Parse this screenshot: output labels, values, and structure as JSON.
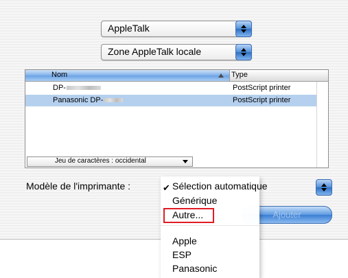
{
  "connection_popup": {
    "value": "AppleTalk"
  },
  "zone_popup": {
    "value": "Zone AppleTalk locale"
  },
  "printer_list": {
    "columns": [
      "Nom",
      "Type"
    ],
    "rows": [
      {
        "name": "DP-",
        "type": "PostScript printer",
        "selected": false
      },
      {
        "name": "Panasonic DP-",
        "type": "PostScript printer",
        "selected": true
      }
    ],
    "charset_label": "Jeu de caractères : occidental"
  },
  "model": {
    "label": "Modèle de l'imprimante :",
    "menu_items": [
      {
        "label": "Sélection automatique",
        "checked": true
      },
      {
        "label": "Générique"
      },
      {
        "label": "Autre...",
        "highlighted": true
      },
      {
        "label": "Apple"
      },
      {
        "label": "ESP"
      },
      {
        "label": "Panasonic"
      }
    ]
  },
  "buttons": {
    "add_label": "Ajouter"
  },
  "colors": {
    "highlight_box": "#e01b24",
    "selection": "#b5d0ee",
    "accent": "#3b7ed4"
  }
}
